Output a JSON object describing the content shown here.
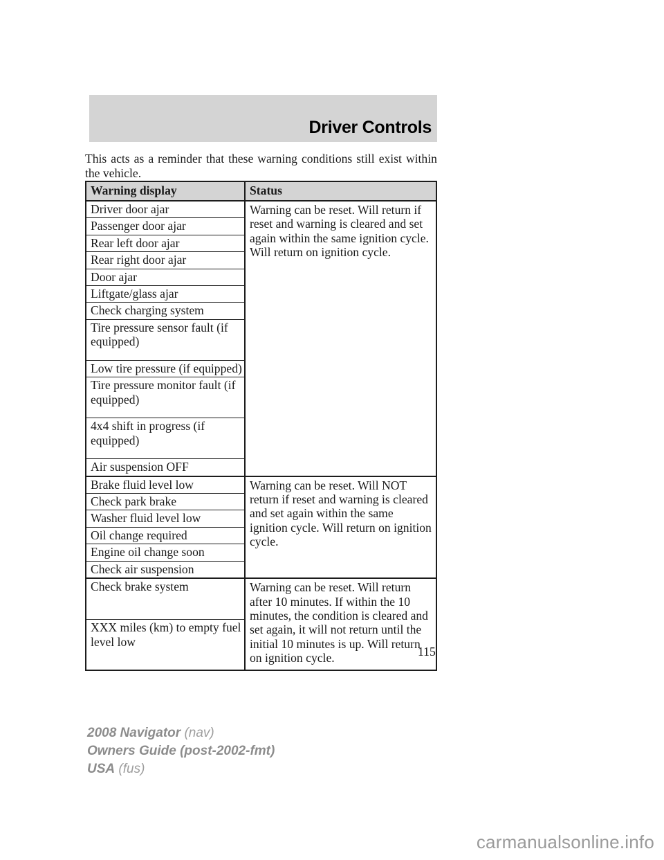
{
  "document": {
    "section_title": "Driver Controls",
    "page_number": "115",
    "watermark": "carmanualsonline.info"
  },
  "intro": {
    "line1": "This acts as a reminder that these warning conditions still exist within",
    "line2": "the vehicle."
  },
  "table": {
    "headers": {
      "warning": "Warning display",
      "status": "Status"
    },
    "groups": [
      {
        "status": "Warning can be reset. Will return if reset and warning is cleared and set again within the same ignition cycle. Will return on ignition cycle.",
        "status_lines": [
          "Warning can be reset. Will return if",
          "reset and warning is cleared and set",
          "again within the same ignition cycle.",
          "Will return on ignition cycle."
        ],
        "warnings": [
          {
            "text": "Driver door ajar",
            "lines": [
              "Driver door ajar"
            ]
          },
          {
            "text": "Passenger door ajar",
            "lines": [
              "Passenger door ajar"
            ]
          },
          {
            "text": "Rear left door ajar",
            "lines": [
              "Rear left door ajar"
            ]
          },
          {
            "text": "Rear right door ajar",
            "lines": [
              "Rear right door ajar"
            ]
          },
          {
            "text": "Door ajar",
            "lines": [
              "Door ajar"
            ]
          },
          {
            "text": "Liftgate/glass ajar",
            "lines": [
              "Liftgate/glass ajar"
            ]
          },
          {
            "text": "Check charging system",
            "lines": [
              "Check charging system"
            ]
          },
          {
            "text": "Tire pressure sensor fault (if equipped)",
            "lines": [
              "Tire pressure sensor fault (if",
              "equipped)"
            ]
          },
          {
            "text": "Low tire pressure (if equipped)",
            "lines": [
              "Low tire pressure (if equipped)"
            ]
          },
          {
            "text": "Tire pressure monitor fault (if equipped)",
            "lines": [
              "Tire pressure monitor fault (if",
              "equipped)"
            ]
          },
          {
            "text": "4x4 shift in progress (if equipped)",
            "lines": [
              "4x4 shift in progress (if",
              "equipped)"
            ]
          },
          {
            "text": "Air suspension OFF",
            "lines": [
              "Air suspension OFF"
            ]
          }
        ]
      },
      {
        "status": "Warning can be reset. Will NOT return if reset and warning is cleared and set again within the same ignition cycle. Will return on ignition cycle.",
        "status_lines": [
          "Warning can be reset. Will NOT return",
          "if reset and warning is cleared and set",
          "again within the same ignition cycle.",
          "Will return on ignition cycle."
        ],
        "warnings": [
          {
            "text": "Brake fluid level low",
            "lines": [
              "Brake fluid level low"
            ]
          },
          {
            "text": "Check park brake",
            "lines": [
              "Check park brake"
            ]
          },
          {
            "text": "Washer fluid level low",
            "lines": [
              "Washer fluid level low"
            ]
          },
          {
            "text": "Oil change required",
            "lines": [
              "Oil change required"
            ]
          },
          {
            "text": "Engine oil change soon",
            "lines": [
              "Engine oil change soon"
            ]
          },
          {
            "text": "Check air suspension",
            "lines": [
              "Check air suspension"
            ]
          }
        ]
      },
      {
        "status": "Warning can be reset. Will return after 10 minutes. If within the 10 minutes, the condition is cleared and set again, it will not return until the initial 10 minutes is up. Will return on ignition cycle.",
        "status_lines": [
          "Warning can be reset. Will return after",
          "10 minutes. If within the 10 minutes,",
          "the condition is cleared and set again,",
          "it will not return until the initial 10",
          "minutes is up. Will return on ignition",
          "cycle."
        ],
        "warnings": [
          {
            "text": "Check brake system",
            "lines": [
              "Check brake system"
            ]
          },
          {
            "text": "XXX miles (km) to empty fuel level low",
            "lines": [
              "XXX miles (km) to empty fuel",
              "level low"
            ]
          }
        ]
      }
    ]
  },
  "footer": {
    "line1_bold": "2008 Navigator",
    "line1_light": "(nav)",
    "line2_bold": "Owners Guide (post-2002-fmt)",
    "line3_bold": "USA",
    "line3_light": "(fus)"
  },
  "colors": {
    "banner_gray": "#d4d4d4",
    "rule_black": "#1c1c1c",
    "footer_gray": "#8c8c8c",
    "watermark_gray": "#9a9a9a"
  }
}
